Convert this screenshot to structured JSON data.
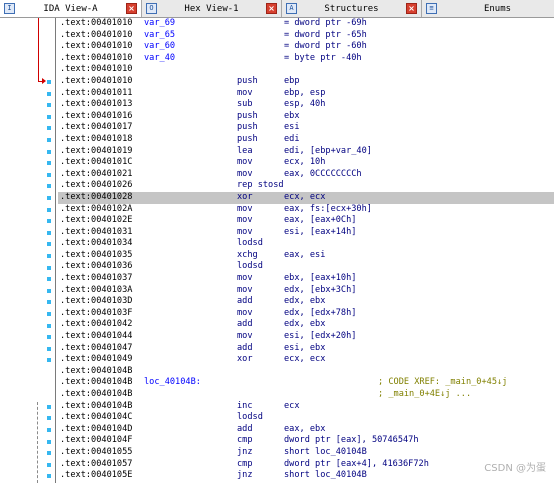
{
  "tabs": [
    {
      "label": "IDA View-A",
      "icon": "I",
      "active": true,
      "close": "×"
    },
    {
      "label": "Hex View-1",
      "icon": "O",
      "active": false,
      "close": "×"
    },
    {
      "label": "Structures",
      "icon": "A",
      "active": false,
      "close": "×"
    },
    {
      "label": "Enums",
      "icon": "≡",
      "active": false,
      "close": ""
    }
  ],
  "listing": {
    "rows": [
      {
        "addr": ".text:00401010",
        "label": "var_69",
        "mn": "",
        "op": "= dword ptr -69h",
        "cmt": ""
      },
      {
        "addr": ".text:00401010",
        "label": "var_65",
        "mn": "",
        "op": "= dword ptr -65h",
        "cmt": ""
      },
      {
        "addr": ".text:00401010",
        "label": "var_60",
        "mn": "",
        "op": "= dword ptr -60h",
        "cmt": ""
      },
      {
        "addr": ".text:00401010",
        "label": "var_40",
        "mn": "",
        "op": "= byte ptr -40h",
        "cmt": ""
      },
      {
        "addr": ".text:00401010",
        "label": "",
        "mn": "",
        "op": "",
        "cmt": ""
      },
      {
        "addr": ".text:00401010",
        "label": "",
        "mn": "push",
        "op": "ebp",
        "cmt": ""
      },
      {
        "addr": ".text:00401011",
        "label": "",
        "mn": "mov",
        "op": "ebp, esp",
        "cmt": ""
      },
      {
        "addr": ".text:00401013",
        "label": "",
        "mn": "sub",
        "op": "esp, 40h",
        "cmt": ""
      },
      {
        "addr": ".text:00401016",
        "label": "",
        "mn": "push",
        "op": "ebx",
        "cmt": ""
      },
      {
        "addr": ".text:00401017",
        "label": "",
        "mn": "push",
        "op": "esi",
        "cmt": ""
      },
      {
        "addr": ".text:00401018",
        "label": "",
        "mn": "push",
        "op": "edi",
        "cmt": ""
      },
      {
        "addr": ".text:00401019",
        "label": "",
        "mn": "lea",
        "op": "edi, [ebp+var_40]",
        "cmt": ""
      },
      {
        "addr": ".text:0040101C",
        "label": "",
        "mn": "mov",
        "op": "ecx, 10h",
        "cmt": ""
      },
      {
        "addr": ".text:00401021",
        "label": "",
        "mn": "mov",
        "op": "eax, 0CCCCCCCCh",
        "cmt": ""
      },
      {
        "addr": ".text:00401026",
        "label": "",
        "mn": "rep stosd",
        "op": "",
        "cmt": ""
      },
      {
        "addr": ".text:00401028",
        "label": "",
        "mn": "xor",
        "op": "ecx, ecx",
        "cmt": "",
        "selected": true
      },
      {
        "addr": ".text:0040102A",
        "label": "",
        "mn": "mov",
        "op": "eax, fs:[ecx+30h]",
        "cmt": ""
      },
      {
        "addr": ".text:0040102E",
        "label": "",
        "mn": "mov",
        "op": "eax, [eax+0Ch]",
        "cmt": ""
      },
      {
        "addr": ".text:00401031",
        "label": "",
        "mn": "mov",
        "op": "esi, [eax+14h]",
        "cmt": ""
      },
      {
        "addr": ".text:00401034",
        "label": "",
        "mn": "lodsd",
        "op": "",
        "cmt": ""
      },
      {
        "addr": ".text:00401035",
        "label": "",
        "mn": "xchg",
        "op": "eax, esi",
        "cmt": ""
      },
      {
        "addr": ".text:00401036",
        "label": "",
        "mn": "lodsd",
        "op": "",
        "cmt": ""
      },
      {
        "addr": ".text:00401037",
        "label": "",
        "mn": "mov",
        "op": "ebx, [eax+10h]",
        "cmt": ""
      },
      {
        "addr": ".text:0040103A",
        "label": "",
        "mn": "mov",
        "op": "edx, [ebx+3Ch]",
        "cmt": ""
      },
      {
        "addr": ".text:0040103D",
        "label": "",
        "mn": "add",
        "op": "edx, ebx",
        "cmt": ""
      },
      {
        "addr": ".text:0040103F",
        "label": "",
        "mn": "mov",
        "op": "edx, [edx+78h]",
        "cmt": ""
      },
      {
        "addr": ".text:00401042",
        "label": "",
        "mn": "add",
        "op": "edx, ebx",
        "cmt": ""
      },
      {
        "addr": ".text:00401044",
        "label": "",
        "mn": "mov",
        "op": "esi, [edx+20h]",
        "cmt": ""
      },
      {
        "addr": ".text:00401047",
        "label": "",
        "mn": "add",
        "op": "esi, ebx",
        "cmt": ""
      },
      {
        "addr": ".text:00401049",
        "label": "",
        "mn": "xor",
        "op": "ecx, ecx",
        "cmt": ""
      },
      {
        "addr": ".text:0040104B",
        "label": "",
        "mn": "",
        "op": "",
        "cmt": ""
      },
      {
        "addr": ".text:0040104B",
        "label": "loc_40104B:",
        "mn": "",
        "op": "",
        "cmt": "; CODE XREF: _main_0+45↓j"
      },
      {
        "addr": ".text:0040104B",
        "label": "",
        "mn": "",
        "op": "",
        "cmt": "; _main_0+4E↓j ..."
      },
      {
        "addr": ".text:0040104B",
        "label": "",
        "mn": "inc",
        "op": "ecx",
        "cmt": ""
      },
      {
        "addr": ".text:0040104C",
        "label": "",
        "mn": "lodsd",
        "op": "",
        "cmt": ""
      },
      {
        "addr": ".text:0040104D",
        "label": "",
        "mn": "add",
        "op": "eax, ebx",
        "cmt": ""
      },
      {
        "addr": ".text:0040104F",
        "label": "",
        "mn": "cmp",
        "op": "dword ptr [eax], 50746547h",
        "cmt": ""
      },
      {
        "addr": ".text:00401055",
        "label": "",
        "mn": "jnz",
        "op": "short loc_40104B",
        "cmt": ""
      },
      {
        "addr": ".text:00401057",
        "label": "",
        "mn": "cmp",
        "op": "dword ptr [eax+4], 41636F72h",
        "cmt": ""
      },
      {
        "addr": ".text:0040105E",
        "label": "",
        "mn": "jnz",
        "op": "short loc_40104B",
        "cmt": ""
      }
    ]
  },
  "watermark": "CSDN @为蛋",
  "colors": {
    "address": "#000000",
    "label": "#0000ff",
    "instruction": "#000080",
    "comment": "#808000",
    "selection": "#c5c5c5",
    "breakpoint_dot": "#35b7f0",
    "jump_arrow": "#d00000"
  }
}
